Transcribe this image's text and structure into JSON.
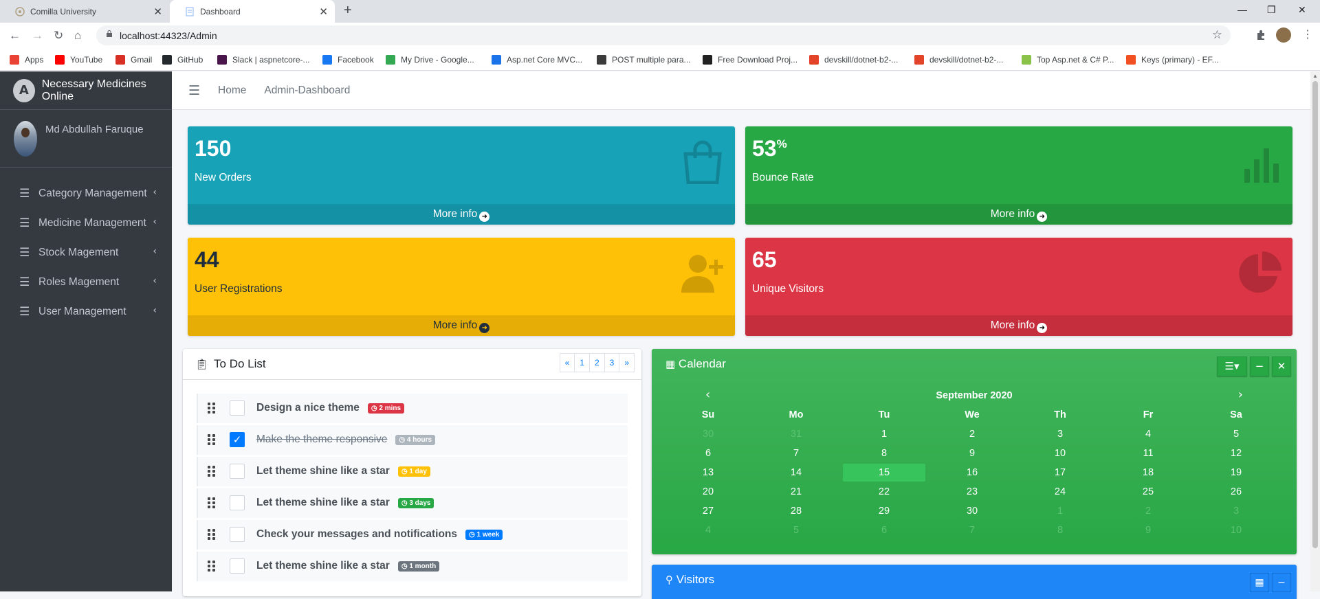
{
  "browser": {
    "tabs": [
      {
        "title": "Comilla University"
      },
      {
        "title": "Dashboard"
      }
    ],
    "url": "localhost:44323/Admin",
    "bookmarks": [
      {
        "label": "Apps",
        "color": "#ea4335"
      },
      {
        "label": "YouTube",
        "color": "#ff0000"
      },
      {
        "label": "Gmail",
        "color": "#d93025"
      },
      {
        "label": "GitHub",
        "color": "#24292e"
      },
      {
        "label": "Slack | aspnetcore-...",
        "color": "#4a154b"
      },
      {
        "label": "Facebook",
        "color": "#1877f2"
      },
      {
        "label": "My Drive - Google...",
        "color": "#34a853"
      },
      {
        "label": "Asp.net Core MVC...",
        "color": "#1a73e8"
      },
      {
        "label": "POST multiple para...",
        "color": "#3c3c3c"
      },
      {
        "label": "Free Download Proj...",
        "color": "#222222"
      },
      {
        "label": "devskill/dotnet-b2-...",
        "color": "#e24329"
      },
      {
        "label": "devskill/dotnet-b2-...",
        "color": "#e24329"
      },
      {
        "label": "Top Asp.net & C# P...",
        "color": "#8bc34a"
      },
      {
        "label": "Keys (primary) - EF...",
        "color": "#f25022"
      }
    ]
  },
  "sidebar": {
    "brand": "Necessary Medicines Online",
    "brand_logo": "A",
    "user_name": "Md Abdullah Faruque",
    "items": [
      {
        "label": "Category Management"
      },
      {
        "label": "Medicine Management"
      },
      {
        "label": "Stock Magement"
      },
      {
        "label": "Roles Magement"
      },
      {
        "label": "User Management"
      }
    ]
  },
  "topnav": {
    "links": [
      "Home",
      "Admin-Dashboard"
    ]
  },
  "stats": [
    {
      "value": "150",
      "sup": "",
      "label": "New Orders",
      "more": "More info",
      "color": "#17a2b8",
      "icon": "shopping-bag-icon"
    },
    {
      "value": "53",
      "sup": "%",
      "label": "Bounce Rate",
      "more": "More info",
      "color": "#28a745",
      "icon": "bar-chart-icon"
    },
    {
      "value": "44",
      "sup": "",
      "label": "User Registrations",
      "more": "More info",
      "color": "#ffc107",
      "icon": "user-plus-icon"
    },
    {
      "value": "65",
      "sup": "",
      "label": "Unique Visitors",
      "more": "More info",
      "color": "#dc3545",
      "icon": "pie-chart-icon"
    }
  ],
  "todo": {
    "title": "To Do List",
    "pager": [
      "«",
      "1",
      "2",
      "3",
      "»"
    ],
    "items": [
      {
        "text": "Design a nice theme",
        "badge": "2 mins",
        "badge_color": "#dc3545",
        "done": false
      },
      {
        "text": "Make the theme responsive",
        "badge": "4 hours",
        "badge_color": "#adb5bd",
        "done": true
      },
      {
        "text": "Let theme shine like a star",
        "badge": "1 day",
        "badge_color": "#ffc107",
        "done": false
      },
      {
        "text": "Let theme shine like a star",
        "badge": "3 days",
        "badge_color": "#28a745",
        "done": false
      },
      {
        "text": "Check your messages and notifications",
        "badge": "1 week",
        "badge_color": "#007bff",
        "done": false
      },
      {
        "text": "Let theme shine like a star",
        "badge": "1 month",
        "badge_color": "#6c757d",
        "done": false
      }
    ]
  },
  "calendar": {
    "title": "Calendar",
    "month": "September 2020",
    "days": [
      "Su",
      "Mo",
      "Tu",
      "We",
      "Th",
      "Fr",
      "Sa"
    ],
    "weeks": [
      [
        "30",
        "31",
        "1",
        "2",
        "3",
        "4",
        "5"
      ],
      [
        "6",
        "7",
        "8",
        "9",
        "10",
        "11",
        "12"
      ],
      [
        "13",
        "14",
        "15",
        "16",
        "17",
        "18",
        "19"
      ],
      [
        "20",
        "21",
        "22",
        "23",
        "24",
        "25",
        "26"
      ],
      [
        "27",
        "28",
        "29",
        "30",
        "1",
        "2",
        "3"
      ],
      [
        "4",
        "5",
        "6",
        "7",
        "8",
        "9",
        "10"
      ]
    ],
    "today": "15"
  },
  "visitors": {
    "title": "Visitors"
  }
}
